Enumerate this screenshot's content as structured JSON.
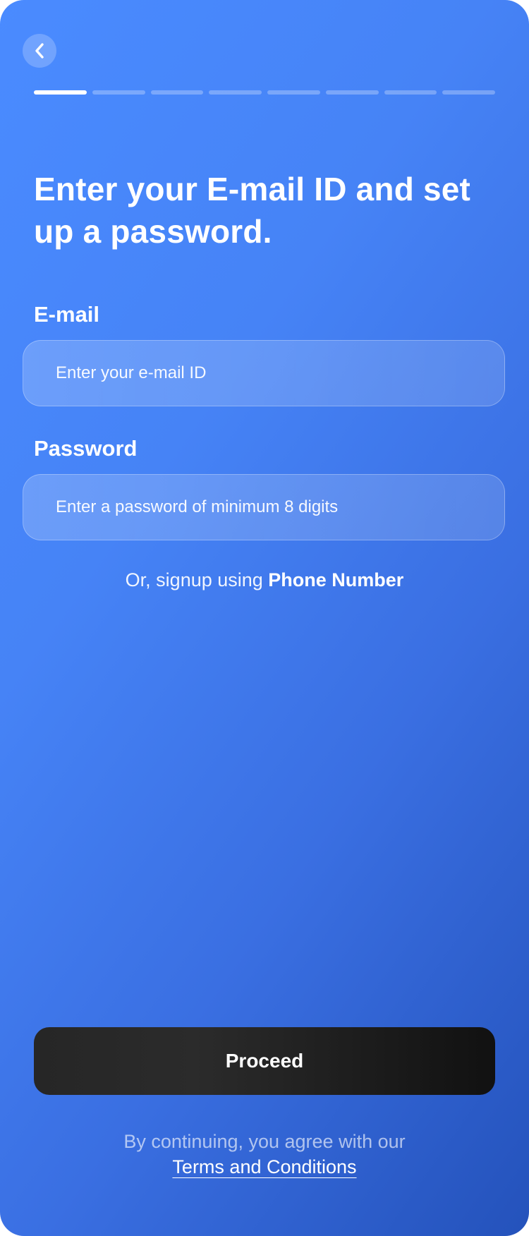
{
  "navigation": {
    "back_icon": "chevron-left-icon"
  },
  "progress": {
    "total_steps": 8,
    "current_step": 1
  },
  "header": {
    "title": "Enter your E-mail ID and set up a password."
  },
  "form": {
    "email": {
      "label": "E-mail",
      "placeholder": "Enter your e-mail ID",
      "value": ""
    },
    "password": {
      "label": "Password",
      "placeholder": "Enter a password of minimum 8 digits",
      "value": ""
    }
  },
  "alt_signup": {
    "prefix": "Or, signup using ",
    "link_label": "Phone Number"
  },
  "actions": {
    "proceed_label": "Proceed"
  },
  "footer": {
    "text": "By continuing, you agree with our",
    "terms_label": "Terms and Conditions"
  },
  "colors": {
    "gradient_start": "#4a8bff",
    "gradient_end": "#2452bb",
    "button_dark": "#1c1c1c",
    "text_white": "#ffffff"
  }
}
